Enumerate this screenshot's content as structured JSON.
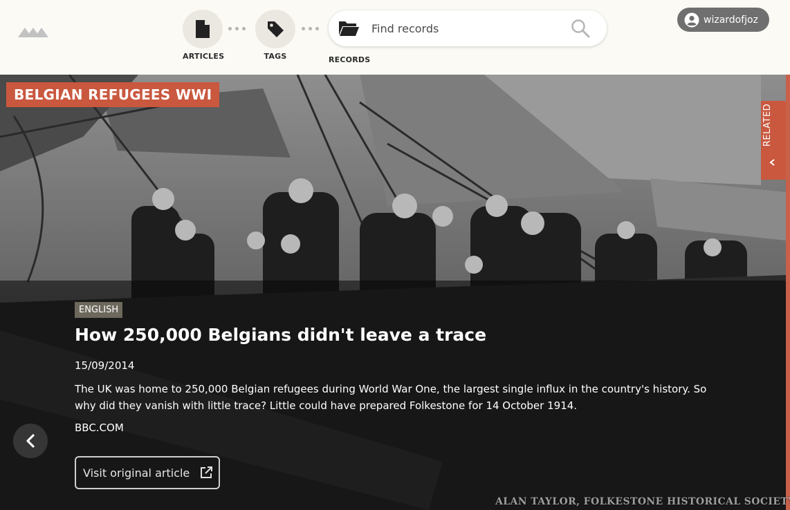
{
  "header": {
    "nav": [
      {
        "label": "ARTICLES",
        "icon": "document-icon"
      },
      {
        "label": "TAGS",
        "icon": "tag-icon"
      },
      {
        "label": "RECORDS",
        "icon": "folder-open-icon"
      }
    ],
    "search": {
      "placeholder": "Find records",
      "value": ""
    },
    "user": {
      "name": "wizardofjoz"
    }
  },
  "collection": {
    "title": "BELGIAN REFUGEES WWI"
  },
  "related_tab": {
    "label": "RELATED"
  },
  "article": {
    "language": "ENGLISH",
    "title": "How 250,000 Belgians didn't leave a trace",
    "date": "15/09/2014",
    "description": "The UK was home to 250,000 Belgian refugees during World War One, the largest single influx in the country's history. So why did they vanish with little trace? Little could have prepared Folkestone for 14 October 1914.",
    "source": "BBC.COM",
    "visit_label": "Visit original article"
  },
  "image_credit": "ALAN TAYLOR, FOLKESTONE HISTORICAL SOCIETY",
  "colors": {
    "accent": "#c9583f",
    "header_bg": "#fbfaf5",
    "user_button": "#6f6f6f",
    "language_badge": "#6d685c"
  }
}
